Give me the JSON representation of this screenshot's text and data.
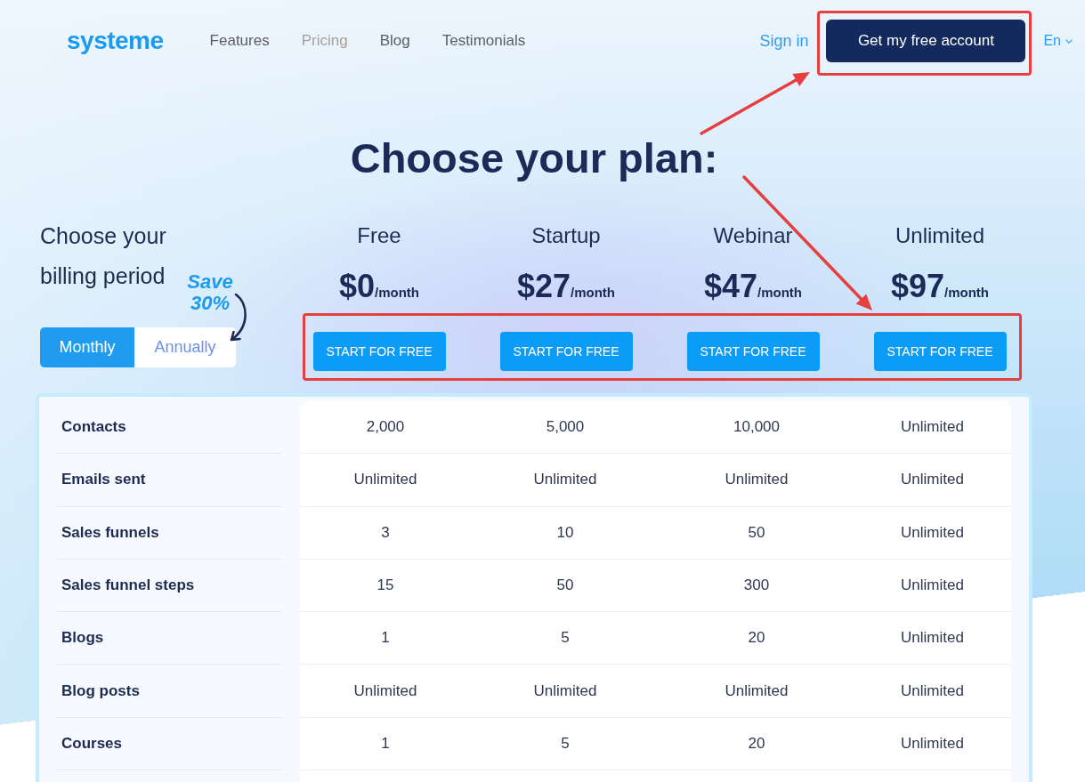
{
  "nav": {
    "logo": "systeme",
    "links": [
      {
        "label": "Features",
        "selected": false
      },
      {
        "label": "Pricing",
        "selected": true
      },
      {
        "label": "Blog",
        "selected": false
      },
      {
        "label": "Testimonials",
        "selected": false
      }
    ],
    "sign_in": "Sign in",
    "cta": {
      "label": "Get my free account",
      "highlighted": true
    },
    "language": "En"
  },
  "heading": "Choose your plan:",
  "billing": {
    "title": "Choose your billing period",
    "note": "Save 30%",
    "periods": [
      {
        "label": "Monthly",
        "selected": true
      },
      {
        "label": "Annually",
        "selected": false
      }
    ]
  },
  "plans": {
    "buttons_highlighted": true,
    "items": [
      {
        "name": "Free",
        "price": "$0",
        "period": "/month",
        "button": "START FOR FREE"
      },
      {
        "name": "Startup",
        "price": "$27",
        "period": "/month",
        "button": "START FOR FREE"
      },
      {
        "name": "Webinar",
        "price": "$47",
        "period": "/month",
        "button": "START FOR FREE"
      },
      {
        "name": "Unlimited",
        "price": "$97",
        "period": "/month",
        "button": "START FOR FREE"
      }
    ]
  },
  "features": [
    {
      "label": "Contacts",
      "values": [
        "2,000",
        "5,000",
        "10,000",
        "Unlimited"
      ]
    },
    {
      "label": "Emails sent",
      "values": [
        "Unlimited",
        "Unlimited",
        "Unlimited",
        "Unlimited"
      ]
    },
    {
      "label": "Sales funnels",
      "values": [
        "3",
        "10",
        "50",
        "Unlimited"
      ]
    },
    {
      "label": "Sales funnel steps",
      "values": [
        "15",
        "50",
        "300",
        "Unlimited"
      ]
    },
    {
      "label": "Blogs",
      "values": [
        "1",
        "5",
        "20",
        "Unlimited"
      ]
    },
    {
      "label": "Blog posts",
      "values": [
        "Unlimited",
        "Unlimited",
        "Unlimited",
        "Unlimited"
      ]
    },
    {
      "label": "Courses",
      "values": [
        "1",
        "5",
        "20",
        "Unlimited"
      ]
    }
  ]
}
